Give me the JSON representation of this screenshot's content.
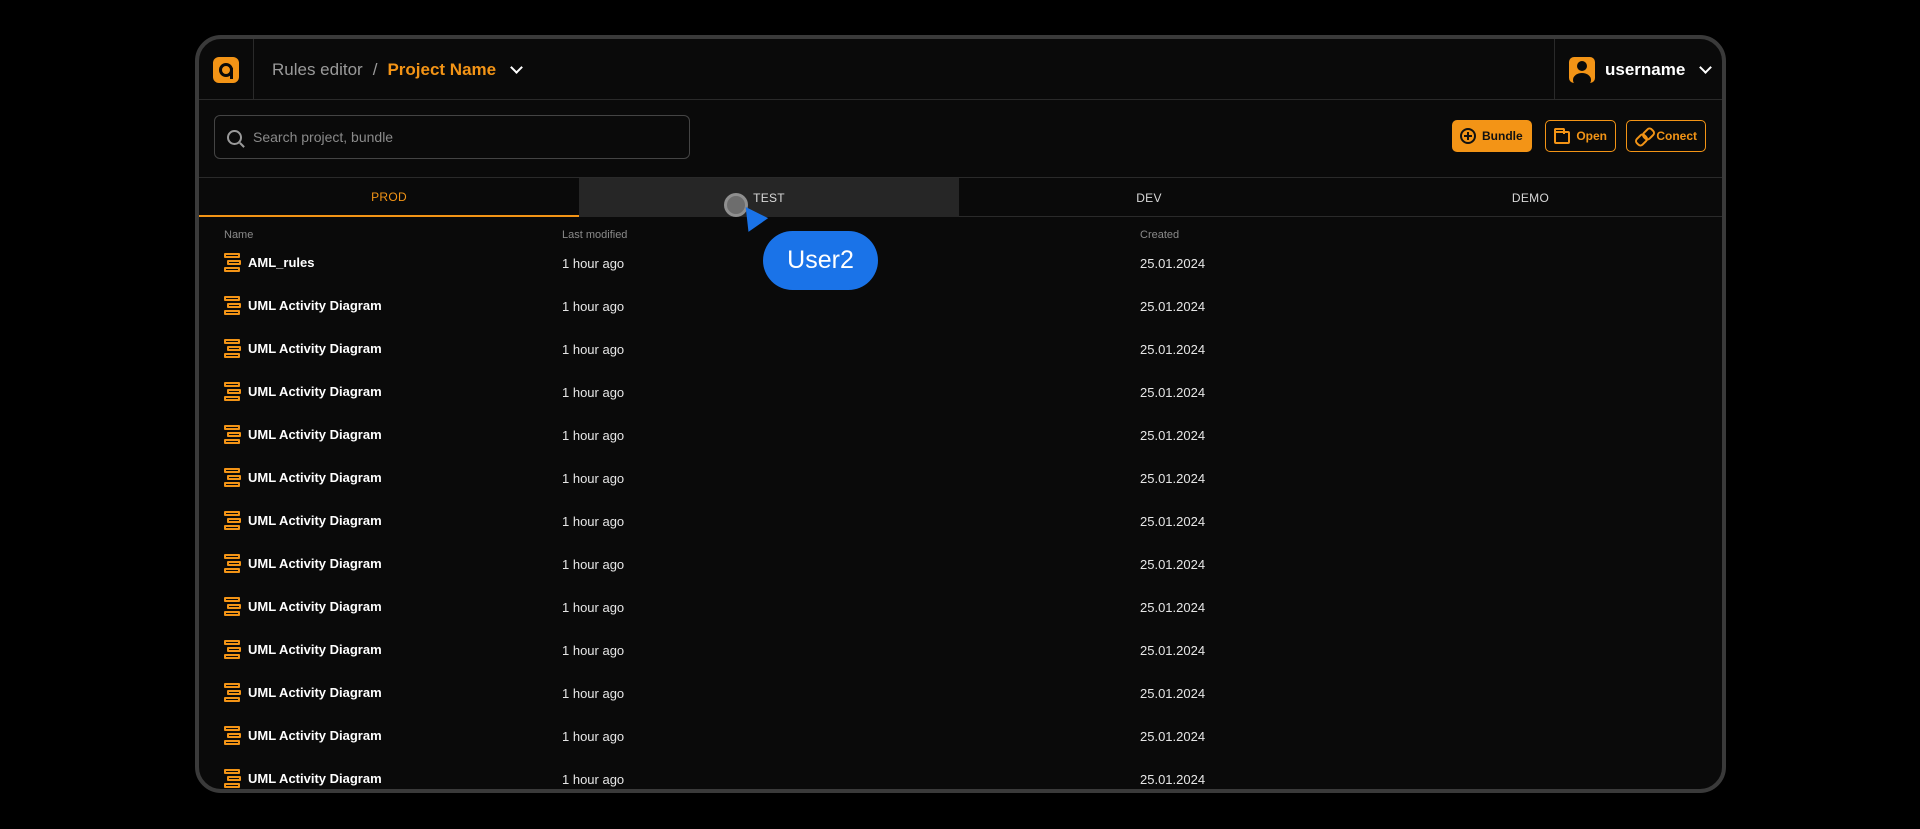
{
  "header": {
    "breadcrumb_root": "Rules editor",
    "breadcrumb_separator": "/",
    "project_name": "Project Name",
    "username": "username"
  },
  "toolbar": {
    "search_placeholder": "Search project, bundle",
    "search_value": "",
    "bundle_label": "Bundle",
    "open_label": "Open",
    "connect_label": "Conect"
  },
  "tabs": [
    {
      "label": "PROD",
      "state": "active"
    },
    {
      "label": "TEST",
      "state": "hover"
    },
    {
      "label": "DEV",
      "state": "default"
    },
    {
      "label": "DEMO",
      "state": "default"
    }
  ],
  "table": {
    "columns": {
      "name": "Name",
      "modified": "Last modified",
      "created": "Created"
    },
    "rows": [
      {
        "name": "AML_rules",
        "modified": "1 hour ago",
        "created": "25.01.2024"
      },
      {
        "name": "UML Activity Diagram",
        "modified": "1 hour ago",
        "created": "25.01.2024"
      },
      {
        "name": "UML Activity Diagram",
        "modified": "1 hour ago",
        "created": "25.01.2024"
      },
      {
        "name": "UML Activity Diagram",
        "modified": "1 hour ago",
        "created": "25.01.2024"
      },
      {
        "name": "UML Activity Diagram",
        "modified": "1 hour ago",
        "created": "25.01.2024"
      },
      {
        "name": "UML Activity Diagram",
        "modified": "1 hour ago",
        "created": "25.01.2024"
      },
      {
        "name": "UML Activity Diagram",
        "modified": "1 hour ago",
        "created": "25.01.2024"
      },
      {
        "name": "UML Activity Diagram",
        "modified": "1 hour ago",
        "created": "25.01.2024"
      },
      {
        "name": "UML Activity Diagram",
        "modified": "1 hour ago",
        "created": "25.01.2024"
      },
      {
        "name": "UML Activity Diagram",
        "modified": "1 hour ago",
        "created": "25.01.2024"
      },
      {
        "name": "UML Activity Diagram",
        "modified": "1 hour ago",
        "created": "25.01.2024"
      },
      {
        "name": "UML Activity Diagram",
        "modified": "1 hour ago",
        "created": "25.01.2024"
      },
      {
        "name": "UML Activity Diagram",
        "modified": "1 hour ago",
        "created": "25.01.2024"
      }
    ]
  },
  "collaborator": {
    "label": "User2"
  },
  "icons": {
    "logo": "app-logo-icon",
    "avatar": "user-avatar-icon",
    "search": "search-icon",
    "bundle": "plus-circle-icon",
    "open": "folder-icon",
    "connect": "link-icon",
    "row": "diagram-icon"
  },
  "colors": {
    "accent": "#f39416",
    "background": "#0a0a0a",
    "collaborator": "#1a73e8",
    "tab_hover": "#262626"
  }
}
